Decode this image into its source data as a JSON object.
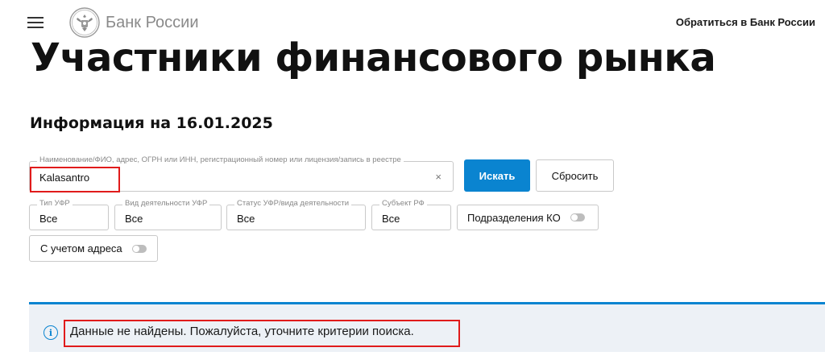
{
  "header": {
    "logo_text": "Банк России",
    "contact_link": "Обратиться в Банк России"
  },
  "page": {
    "title": "Участники финансового рынка",
    "info_date": "Информация на 16.01.2025"
  },
  "search": {
    "label": "Наименование/ФИО, адрес, ОГРН или ИНН, регистрационный номер или лицензия/запись в реестре",
    "value": "Kalasantro",
    "clear_glyph": "×",
    "search_button": "Искать",
    "reset_button": "Сбросить"
  },
  "filters": [
    {
      "label": "Тип УФР",
      "value": "Все"
    },
    {
      "label": "Вид деятельности УФР",
      "value": "Все"
    },
    {
      "label": "Статус УФР/вида деятельности",
      "value": "Все"
    },
    {
      "label": "Субъект РФ",
      "value": "Все"
    }
  ],
  "toggles": {
    "ko_divisions": {
      "label": "Подразделения КО",
      "on": false
    },
    "with_address": {
      "label": "С учетом адреса",
      "on": false
    }
  },
  "notice": {
    "icon": "info-icon",
    "icon_glyph": "i",
    "text": "Данные не найдены. Пожалуйста, уточните критерии поиска."
  },
  "colors": {
    "accent": "#0a84d0",
    "annotation": "#e01b1b",
    "notice_bg": "#edf1f6"
  }
}
